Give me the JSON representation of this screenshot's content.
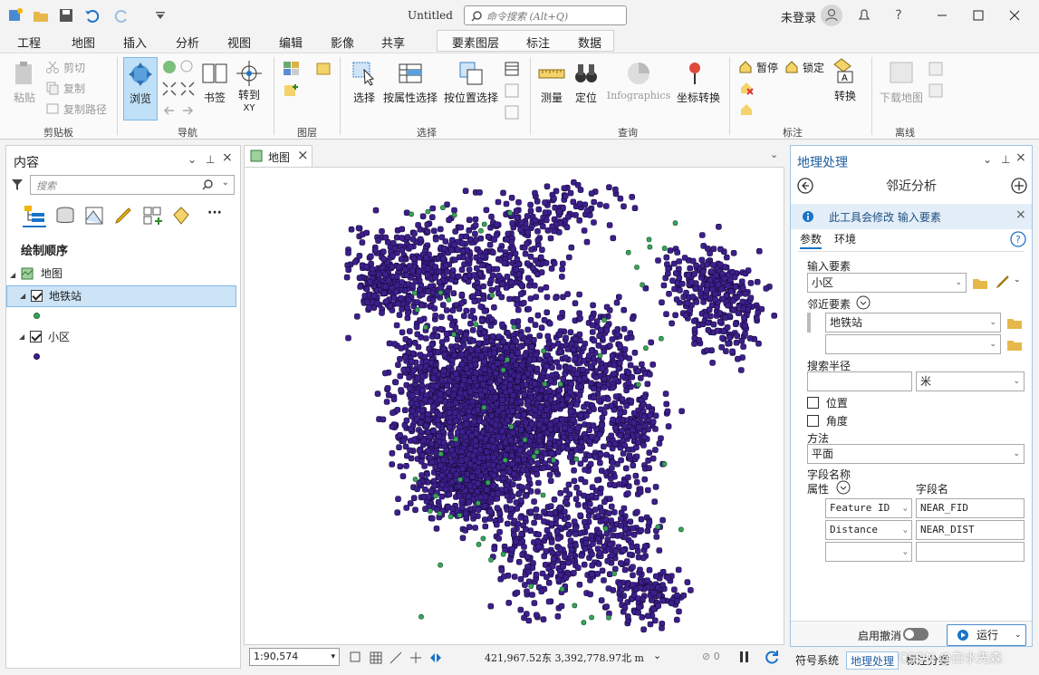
{
  "titlebar": {
    "doc_title": "Untitled",
    "search_placeholder": "命令搜索 (Alt+Q)",
    "login": "未登录"
  },
  "menu": {
    "tabs": [
      "工程",
      "地图",
      "插入",
      "分析",
      "视图",
      "编辑",
      "影像",
      "共享"
    ],
    "active": "地图",
    "context_tabs": [
      "要素图层",
      "标注",
      "数据"
    ]
  },
  "ribbon": {
    "clipboard": {
      "paste": "粘贴",
      "cut": "剪切",
      "copy": "复制",
      "copy_path": "复制路径",
      "label": "剪贴板"
    },
    "navigate": {
      "explore": "浏览",
      "bookmarks": "书签",
      "goto_xy": "转到",
      "goto_xy2": "XY",
      "label": "导航"
    },
    "layer": {
      "label": "图层"
    },
    "selection": {
      "select": "选择",
      "by_attr": "按属性选择",
      "by_loc": "按位置选择",
      "label": "选择"
    },
    "inquiry": {
      "measure": "测量",
      "locate": "定位",
      "infographics": "Infographics",
      "convert_coord": "坐标转换",
      "label": "查询"
    },
    "labeling": {
      "pause": "暂停",
      "lock": "锁定",
      "convert": "转换",
      "label": "标注"
    },
    "offline": {
      "download": "下载地图",
      "label": "离线"
    }
  },
  "contents": {
    "title": "内容",
    "search_placeholder": "搜索",
    "draw_order": "绘制顺序",
    "map": "地图",
    "layers": [
      {
        "name": "地铁站",
        "checked": true,
        "color": "#3aa35a"
      },
      {
        "name": "小区",
        "checked": true,
        "color": "#3d1f8c"
      }
    ]
  },
  "map_view": {
    "tab": "地图",
    "scale": "1:90,574",
    "coords": "421,967.52东 3,392,778.97北 m",
    "point_fill": "#3d1f8c",
    "station_fill": "#3aa35a"
  },
  "geoprocessing": {
    "title": "地理处理",
    "tool": "邻近分析",
    "info": "此工具会修改  输入要素",
    "tabs": {
      "params": "参数",
      "env": "环境"
    },
    "input_features_label": "输入要素",
    "input_features": "小区",
    "near_features_label": "邻近要素",
    "near_features": [
      "地铁站",
      ""
    ],
    "search_radius_label": "搜索半径",
    "search_radius": "",
    "unit": "米",
    "location_label": "位置",
    "angle_label": "角度",
    "method_label": "方法",
    "method": "平面",
    "field_names_label": "字段名称",
    "attr_col": "属性",
    "field_col": "字段名",
    "fields": [
      {
        "attr": "Feature ID",
        "name": "NEAR_FID"
      },
      {
        "attr": "Distance",
        "name": "NEAR_DIST"
      },
      {
        "attr": "",
        "name": ""
      }
    ],
    "undo_label": "启用撤消",
    "run": "运行"
  },
  "bottom_tabs": [
    "符号系统",
    "地理处理",
    "标注分类"
  ],
  "active_bottom": "地理处理",
  "watermark": "CSDN @白水先森"
}
